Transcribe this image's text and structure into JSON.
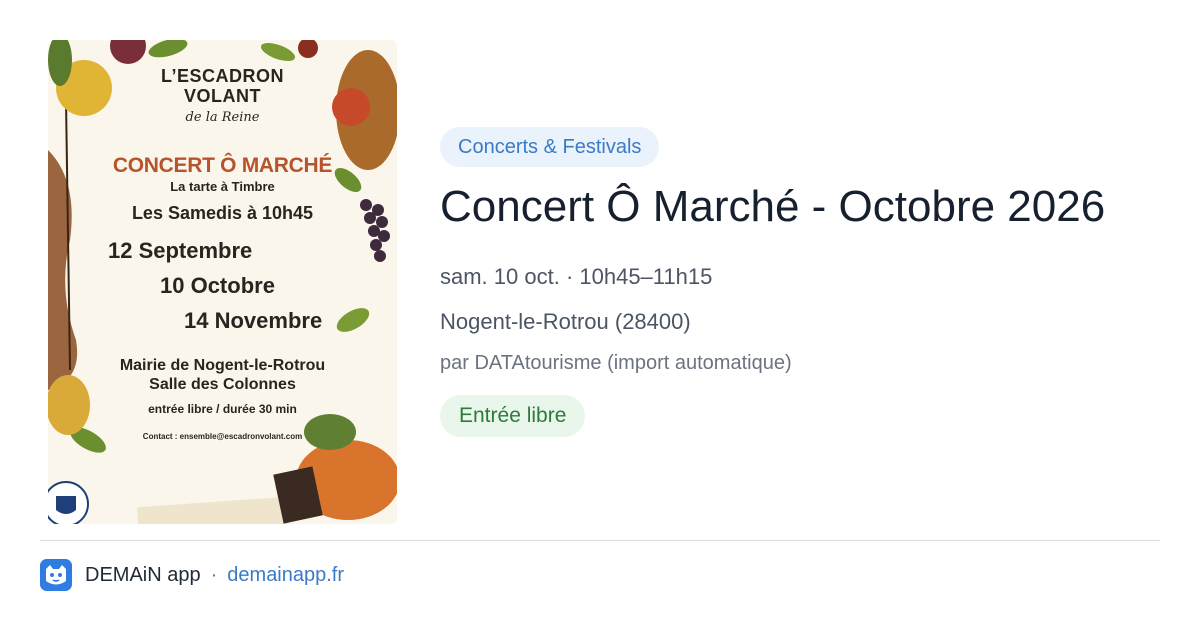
{
  "poster": {
    "org_line1": "L’ESCADRON",
    "org_line2": "VOLANT",
    "org_line3": "de la Reine",
    "title": "CONCERT Ô MARCHÉ",
    "subtitle": "La tarte à Timbre",
    "schedule": "Les Samedis à 10h45",
    "dates": [
      "12 Septembre",
      "10 Octobre",
      "14 Novembre"
    ],
    "venue_line1": "Mairie de Nogent-le-Rotrou",
    "venue_line2": "Salle des Colonnes",
    "entry_info": "entrée libre / durée 30 min",
    "contact": "Contact : ensemble@escadronvolant.com"
  },
  "event": {
    "category": "Concerts & Festivals",
    "title": "Concert Ô Marché - Octobre 2026",
    "date": "sam. 10 oct. · 10h45–11h15",
    "location": "Nogent-le-Rotrou (28400)",
    "source": "par DATAtourisme (import automatique)",
    "price_badge": "Entrée libre"
  },
  "footer": {
    "app_name": "DEMAiN app",
    "separator": "·",
    "link": "demainapp.fr"
  },
  "colors": {
    "category_bg": "#eaf2fb",
    "category_text": "#3a7bc8",
    "free_bg": "#e9f6ec",
    "free_text": "#2d7a3d",
    "title_text": "#16202e",
    "poster_accent": "#b5542d"
  },
  "icons": {
    "app": "demain-app-icon"
  }
}
